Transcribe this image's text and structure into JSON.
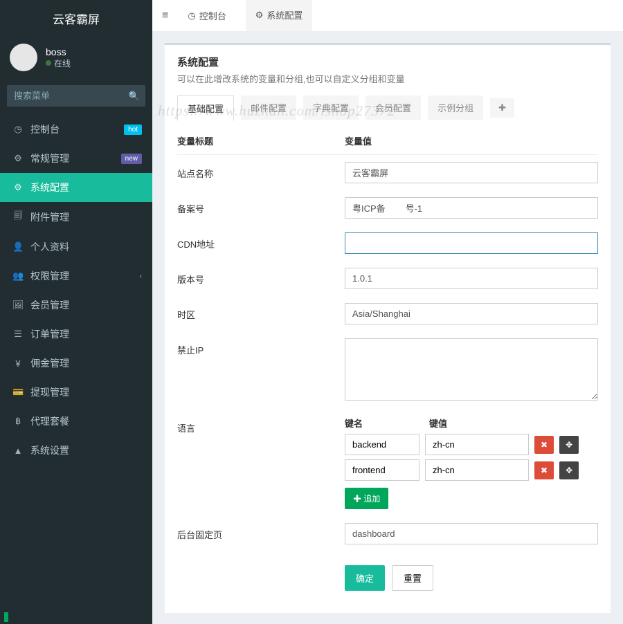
{
  "brand": "云客霸屏",
  "user": {
    "name": "boss",
    "status": "在线"
  },
  "search": {
    "placeholder": "搜索菜单"
  },
  "nav": [
    {
      "icon": "◷",
      "label": "控制台",
      "badge": "hot",
      "badgeClass": "hot"
    },
    {
      "icon": "⚙",
      "label": "常规管理",
      "badge": "new",
      "badgeClass": "new"
    },
    {
      "icon": "⚙",
      "label": "系统配置",
      "active": true
    },
    {
      "icon": "🗐",
      "label": "附件管理"
    },
    {
      "icon": "👤",
      "label": "个人资料"
    },
    {
      "icon": "👥",
      "label": "权限管理",
      "chev": true
    },
    {
      "icon": "🖼",
      "label": "会员管理"
    },
    {
      "icon": "☰",
      "label": "订单管理"
    },
    {
      "icon": "¥",
      "label": "佣金管理"
    },
    {
      "icon": "💳",
      "label": "提现管理"
    },
    {
      "icon": "฿",
      "label": "代理套餐"
    },
    {
      "icon": "▲",
      "label": "系统设置"
    }
  ],
  "topbar": {
    "tab1": "控制台",
    "tab2": "系统配置"
  },
  "panel": {
    "title": "系统配置",
    "desc": "可以在此增改系统的变量和分组,也可以自定义分组和变量"
  },
  "tabs": [
    "基础配置",
    "邮件配置",
    "字典配置",
    "会员配置",
    "示例分组"
  ],
  "form": {
    "head_label": "变量标题",
    "head_value": "变量值",
    "site_name_label": "站点名称",
    "site_name": "云客霸屏",
    "beian_label": "备案号",
    "beian": "粤ICP备        号-1",
    "cdn_label": "CDN地址",
    "cdn": "",
    "version_label": "版本号",
    "version": "1.0.1",
    "tz_label": "时区",
    "tz": "Asia/Shanghai",
    "banip_label": "禁止IP",
    "banip": "",
    "lang_label": "语言",
    "kv_key_head": "键名",
    "kv_val_head": "键值",
    "lang_rows": [
      {
        "key": "backend",
        "val": "zh-cn"
      },
      {
        "key": "frontend",
        "val": "zh-cn"
      }
    ],
    "add_btn": "追加",
    "fixed_label": "后台固定页",
    "fixed": "dashboard",
    "submit": "确定",
    "reset": "重置"
  },
  "watermark": "https://www.huzhan.com/ishop27372"
}
